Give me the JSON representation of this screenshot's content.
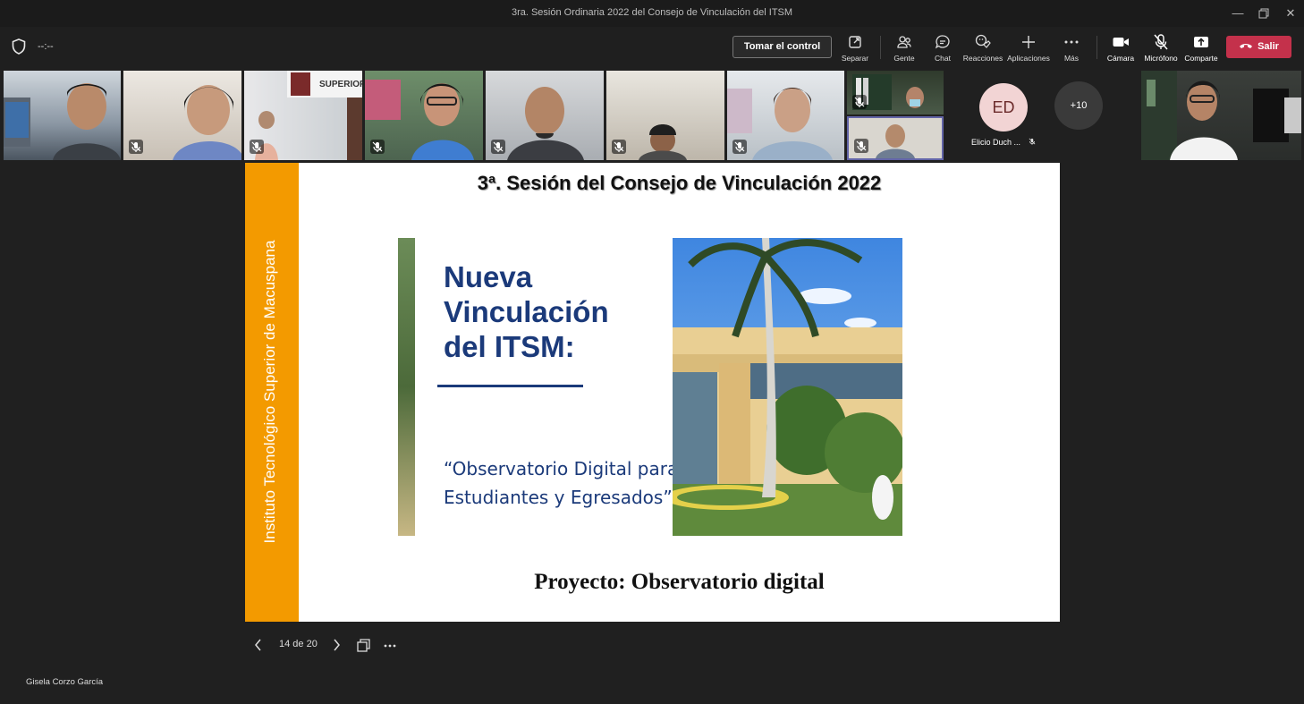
{
  "window": {
    "title": "3ra. Sesión Ordinaria 2022 del Consejo de Vinculación del ITSM",
    "controls": [
      "minimize-icon",
      "restore-icon",
      "close-icon"
    ]
  },
  "toolbar": {
    "timer": "--:--",
    "take_control": "Tomar el control",
    "buttons": [
      {
        "icon": "pop-out-icon",
        "label": "Separar"
      },
      {
        "icon": "people-icon",
        "label": "Gente"
      },
      {
        "icon": "chat-icon",
        "label": "Chat"
      },
      {
        "icon": "reactions-icon",
        "label": "Reacciones"
      },
      {
        "icon": "plus-icon",
        "label": "Aplicaciones"
      },
      {
        "icon": "more-icon",
        "label": "Más"
      },
      {
        "icon": "camera-icon",
        "label": "Cámara"
      },
      {
        "icon": "mic-off-icon",
        "label": "Micrófono"
      },
      {
        "icon": "share-icon",
        "label": "Comparte"
      }
    ],
    "leave": "Salir",
    "colors": {
      "leave": "#c4314b",
      "active_tile_border": "#6264a7"
    }
  },
  "participants": {
    "avatar_initials": "ED",
    "avatar_name": "Elicio Duch ...",
    "overflow": "+10"
  },
  "slide": {
    "vertical_text": "Instituto Tecnológico Superior de Macuspana",
    "heading": "3ª. Sesión del Consejo de Vinculación 2022",
    "title_lines": [
      "Nueva",
      "Vinculación",
      "del ITSM:"
    ],
    "quote_lines": [
      "“Observatorio Digital para",
      "Estudiantes y Egresados”"
    ],
    "footer": "Proyecto: Observatorio digital",
    "colors": {
      "sidebar": "#f39a00",
      "title": "#1b3a7a"
    }
  },
  "slide_nav": {
    "page": "14 de 20"
  },
  "presenter": "Gisela Corzo García"
}
